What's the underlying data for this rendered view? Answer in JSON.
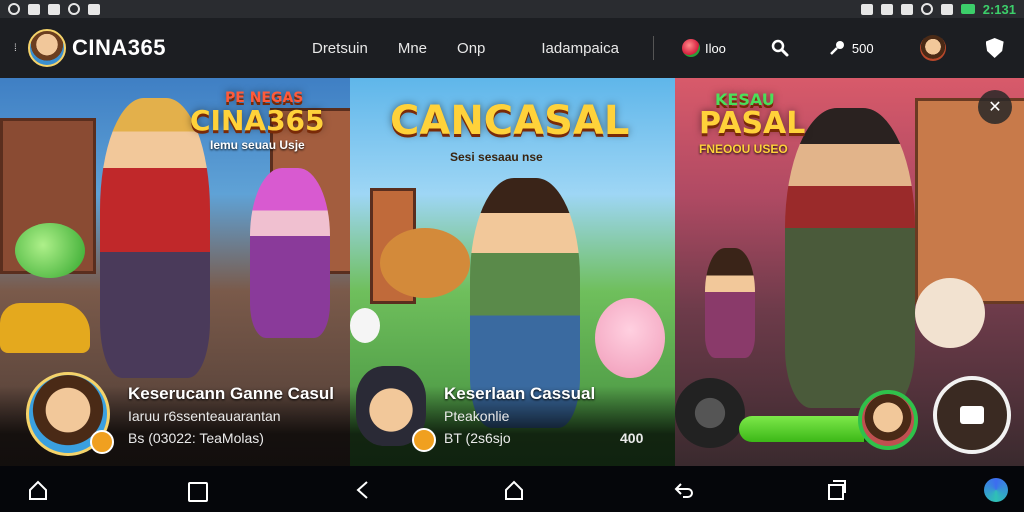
{
  "status_bar": {
    "time": "2:131",
    "left_icons": [
      "camera-icon",
      "image-icon",
      "alert-icon",
      "download-icon",
      "notify-icon"
    ],
    "right_icons": [
      "bluetooth-icon",
      "vibrate-icon",
      "info-icon",
      "wifi-icon",
      "signal-icon",
      "battery-icon"
    ]
  },
  "header": {
    "brand": "CINA365",
    "nav": [
      "Dretsuin",
      "Mne",
      "Onp",
      "Iadampaica"
    ],
    "coins_value": "Iloo",
    "key_value": "500"
  },
  "cards": [
    {
      "game_title": "CINA365",
      "game_title_top": "PE NEGAS",
      "game_subtitle": "Iemu seuau Usje",
      "title": "Keserucann Ganne Casul",
      "line1": "Iaruu r6ssenteauarantan",
      "line2": "Bs (03022: TeaMolas)"
    },
    {
      "game_title": "CANCASAL",
      "game_subtitle": "Sesi sesaau nse",
      "title": "Keserlaan Cassual",
      "line1": "Pteakonlie",
      "line2": "BT (2s6sjo",
      "right_value": "400"
    },
    {
      "game_title": "PASAL",
      "game_title_top": "KESAU",
      "game_subtitle": "FNEOOU USEO",
      "progress": 0.78
    }
  ],
  "bottom_nav": [
    "home",
    "recent",
    "back",
    "home",
    "back",
    "recent",
    "assistant"
  ]
}
